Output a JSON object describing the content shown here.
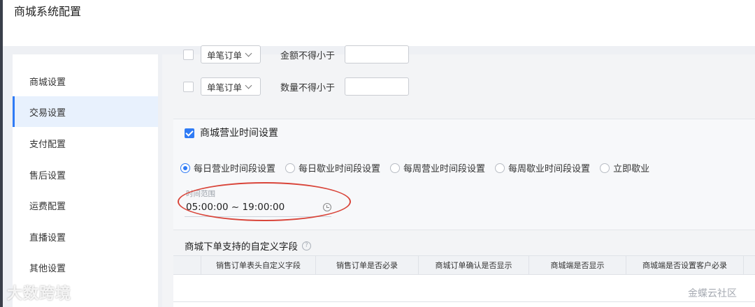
{
  "header": {
    "title": "商城系统配置"
  },
  "sidebar": {
    "items": [
      {
        "label": "商城设置"
      },
      {
        "label": "交易设置"
      },
      {
        "label": "支付配置"
      },
      {
        "label": "售后设置"
      },
      {
        "label": "运费配置"
      },
      {
        "label": "直播设置"
      },
      {
        "label": "其他设置"
      }
    ],
    "active": "交易设置"
  },
  "order_limits": {
    "row1": {
      "select": "单笔订单",
      "label": "金额不得小于",
      "value": ""
    },
    "row2": {
      "select": "单笔订单",
      "label": "数量不得小于",
      "value": ""
    }
  },
  "business_hours": {
    "title": "商城营业时间设置",
    "enabled": true,
    "options": [
      {
        "label": "每日营业时间段设置",
        "selected": true
      },
      {
        "label": "每日歇业时间段设置",
        "selected": false
      },
      {
        "label": "每周营业时间段设置",
        "selected": false
      },
      {
        "label": "每周歇业时间段设置",
        "selected": false
      },
      {
        "label": "立即歇业",
        "selected": false
      }
    ],
    "time_range_label": "时间范围",
    "time_range_value": "05:00:00 ~ 19:00:00"
  },
  "custom_fields": {
    "title": "商城下单支持的自定义字段",
    "help_icon": "question-circle-icon",
    "columns": [
      "",
      "销售订单表头自定义字段",
      "销售订单是否必录",
      "商城订单确认是否显示",
      "商城端是否显示",
      "商城端是否设置客户必录"
    ]
  },
  "watermarks": {
    "left": "大数跨境",
    "right": "金蝶云社区"
  },
  "colors": {
    "accent": "#2f7bf5",
    "annotation": "#d9453a"
  }
}
